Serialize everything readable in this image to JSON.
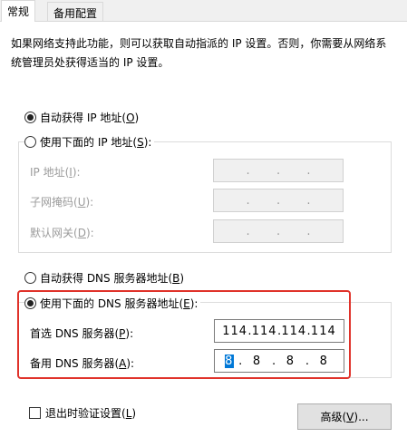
{
  "tabs": [
    {
      "label": "常规"
    },
    {
      "label": "备用配置"
    }
  ],
  "description": "如果网络支持此功能，则可以获取自动指派的 IP 设置。否则，你需要从网络系统管理员处获得适当的 IP 设置。",
  "ip": {
    "auto_label": "自动获得 IP 地址(",
    "auto_key": "O",
    "manual_label": "使用下面的 IP 地址(",
    "manual_key": "S",
    "address_label": "IP 地址(",
    "address_key": "I",
    "mask_label": "子网掩码(",
    "mask_key": "U",
    "gateway_label": "默认网关(",
    "gateway_key": "D",
    "auto_selected": true
  },
  "dns": {
    "auto_label": "自动获得 DNS 服务器地址(",
    "auto_key": "B",
    "manual_label": "使用下面的 DNS 服务器地址(",
    "manual_key": "E",
    "preferred_label": "首选 DNS 服务器(",
    "preferred_key": "P",
    "preferred": [
      "114",
      "114",
      "114",
      "114"
    ],
    "alternate_label": "备用 DNS 服务器(",
    "alternate_key": "A",
    "alternate": [
      "8",
      "8",
      "8",
      "8"
    ],
    "manual_selected": true
  },
  "validate_label": "退出时验证设置(",
  "validate_key": "L",
  "advanced_label": "高级(",
  "advanced_key": "V",
  "advanced_suffix": ")...",
  "close_paren": "):",
  "close_paren_plain": ")",
  "dot": ".",
  "colors": {
    "highlight": "#e0322a",
    "selection": "#0078d7"
  }
}
